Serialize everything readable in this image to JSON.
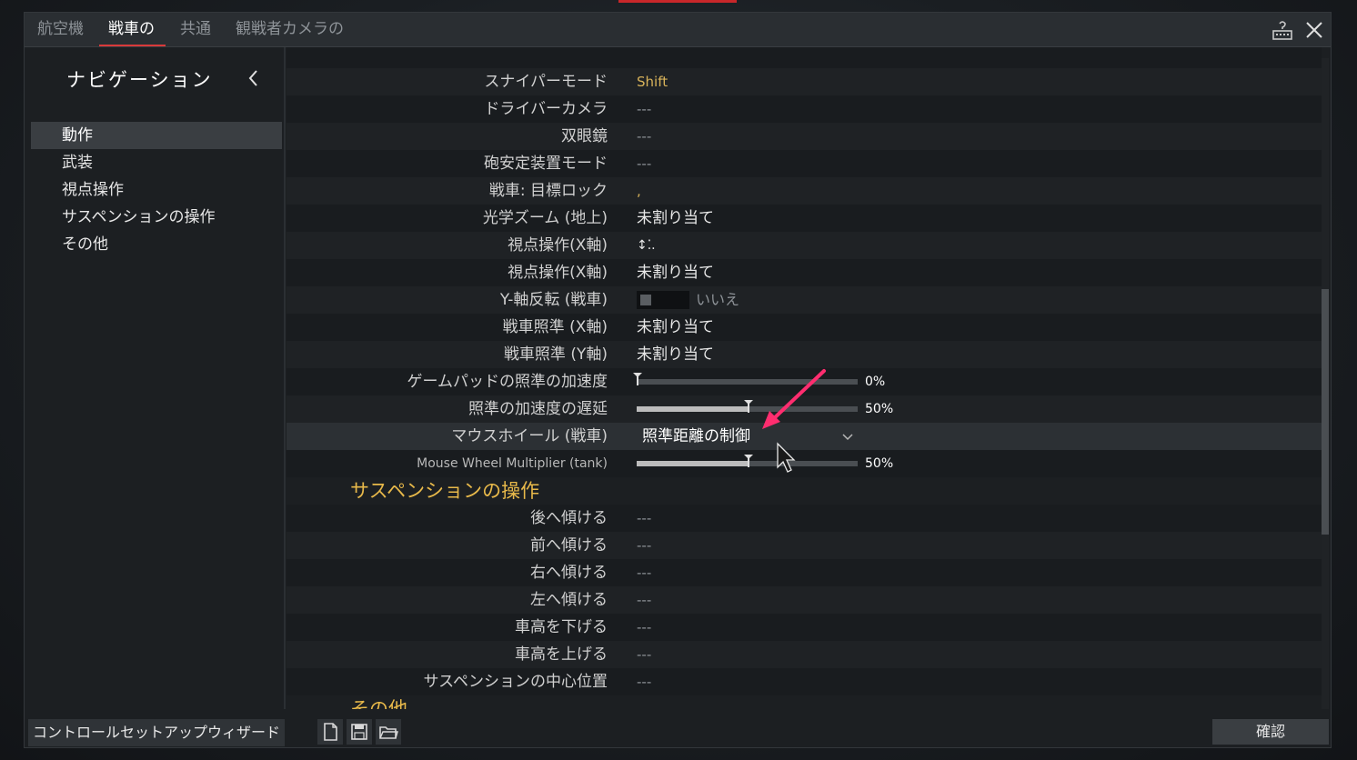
{
  "tabs": [
    {
      "label": "航空機",
      "active": false
    },
    {
      "label": "戦車の",
      "active": true
    },
    {
      "label": "共通",
      "active": false
    },
    {
      "label": "観戦者カメラの",
      "active": false
    }
  ],
  "titlebar_icons": [
    "keyboard-help-icon",
    "close-icon"
  ],
  "sidebar": {
    "title": "ナビゲーション",
    "items": [
      {
        "label": "動作",
        "active": true
      },
      {
        "label": "武装",
        "active": false
      },
      {
        "label": "視点操作",
        "active": false
      },
      {
        "label": "サスペンションの操作",
        "active": false
      },
      {
        "label": "その他",
        "active": false
      }
    ]
  },
  "rows": [
    {
      "label": "スナイパーモード",
      "value": "Shift"
    },
    {
      "label": "ドライバーカメラ",
      "value": "---"
    },
    {
      "label": "双眼鏡",
      "value": "---"
    },
    {
      "label": "砲安定装置モード",
      "value": "---"
    },
    {
      "label": "戦車: 目標ロック",
      "value": ","
    },
    {
      "label": "光学ズーム (地上)",
      "value": "未割り当て"
    },
    {
      "label": "視点操作(X軸)",
      "value": "↕⁚."
    },
    {
      "label": "視点操作(X軸)",
      "value": "未割り当て"
    },
    {
      "label": "Y-軸反転 (戦車)",
      "value": "いいえ",
      "toggle": false
    },
    {
      "label": "戦車照準 (X軸)",
      "value": "未割り当て"
    },
    {
      "label": "戦車照準 (Y軸)",
      "value": "未割り当て"
    },
    {
      "label": "ゲームパッドの照準の加速度",
      "value": "0%",
      "slider": 0
    },
    {
      "label": "照準の加速度の遅延",
      "value": "50%",
      "slider": 0.5
    },
    {
      "label": "マウスホイール (戦車)",
      "value": "照準距離の制御",
      "dropdown": true
    },
    {
      "label": "Mouse Wheel Multiplier (tank)",
      "value": "50%",
      "slider": 0.5
    }
  ],
  "suspension_section": {
    "header": "サスペンションの操作",
    "rows": [
      {
        "label": "後へ傾ける",
        "value": "---"
      },
      {
        "label": "前へ傾ける",
        "value": "---"
      },
      {
        "label": "右へ傾ける",
        "value": "---"
      },
      {
        "label": "左へ傾ける",
        "value": "---"
      },
      {
        "label": "車高を下げる",
        "value": "---"
      },
      {
        "label": "車高を上げる",
        "value": "---"
      },
      {
        "label": "サスペンションの中心位置",
        "value": "---"
      }
    ]
  },
  "other_section": {
    "header": "その他"
  },
  "bottom": {
    "wizard_label": "コントロールセットアップウィザード",
    "icons": [
      "new-file-icon",
      "save-icon",
      "open-folder-icon"
    ],
    "confirm_label": "確認"
  },
  "colors": {
    "accent_red": "#d93a3a",
    "section_gold": "#e8b94a",
    "annotation_pink": "#ff2d6f"
  }
}
